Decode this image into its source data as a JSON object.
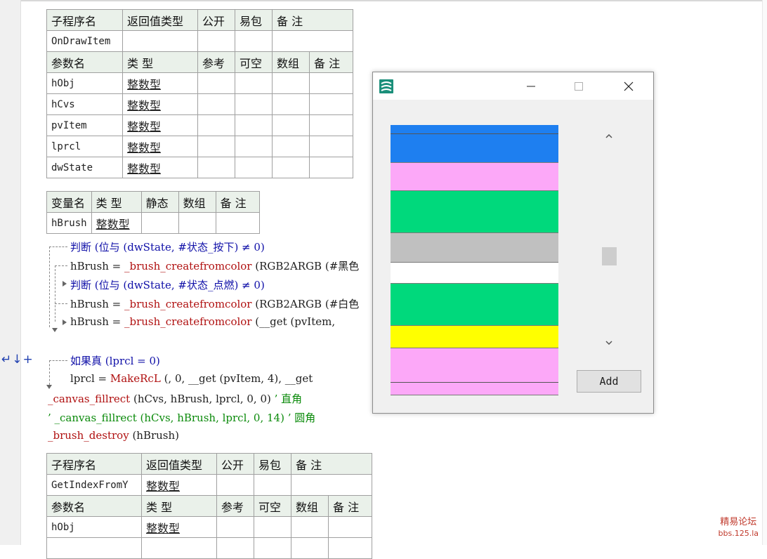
{
  "table1": {
    "header": [
      "子程序名",
      "返回值类型",
      "公开",
      "易包",
      "备 注"
    ],
    "sub_name": "OnDrawItem",
    "param_header": [
      "参数名",
      "类 型",
      "参考",
      "可空",
      "数组",
      "备 注"
    ],
    "params": [
      {
        "name": "hObj",
        "type": "整数型"
      },
      {
        "name": "hCvs",
        "type": "整数型"
      },
      {
        "name": "pvItem",
        "type": "整数型"
      },
      {
        "name": "lprcl",
        "type": "整数型"
      },
      {
        "name": "dwState",
        "type": "整数型"
      }
    ]
  },
  "vartable": {
    "header": [
      "变量名",
      "类 型",
      "静态",
      "数组",
      "备 注"
    ],
    "var_name": "hBrush",
    "var_type": "整数型"
  },
  "code": {
    "l1": "判断 (位与 (dwState, #状态_按下) ≠ 0)",
    "l2a": "hBrush = ",
    "l2b": "_brush_createfromcolor",
    "l2c": " (RGB2ARGB (#黑色",
    "l3": "判断 (位与 (dwState, #状态_点燃) ≠ 0)",
    "l4a": "hBrush = ",
    "l4b": "_brush_createfromcolor",
    "l4c": " (RGB2ARGB (#白色",
    "l5a": "hBrush = ",
    "l5b": "_brush_createfromcolor",
    "l5c": " (__get (pvItem,",
    "l6": "如果真 (lprcl = 0)",
    "l7a": "lprcl = ",
    "l7b": "MakeRcL",
    "l7c": " (, 0, __get (pvItem, 4), __get",
    "l8a": "_canvas_fillrect",
    "l8b": " (hCvs, hBrush, lprcl, 0, 0) ",
    "l8c": "’ 直角",
    "l9": "’ _canvas_fillrect (hCvs, hBrush, lprcl, 0, 14)  ’ 圆角",
    "l10a": "_brush_destroy",
    "l10b": " (hBrush)"
  },
  "table2": {
    "header": [
      "子程序名",
      "返回值类型",
      "公开",
      "易包",
      "备 注"
    ],
    "sub_name": "GetIndexFromY",
    "sub_type": "整数型",
    "param_header": [
      "参数名",
      "类 型",
      "参考",
      "可空",
      "数组",
      "备 注"
    ],
    "params": [
      {
        "name": "hObj",
        "type": "整数型"
      }
    ]
  },
  "gutter_icons": "↵↓+",
  "window": {
    "add_label": "Add",
    "list_colors": [
      "#1e7ff0",
      "#fca8f8",
      "#00d97c",
      "#c0c0c0",
      "#ffffff",
      "#00d97c",
      "#ffff00",
      "#fca8f8"
    ]
  },
  "watermark": {
    "line1": "精易论坛",
    "line2": "bbs.125.la"
  }
}
